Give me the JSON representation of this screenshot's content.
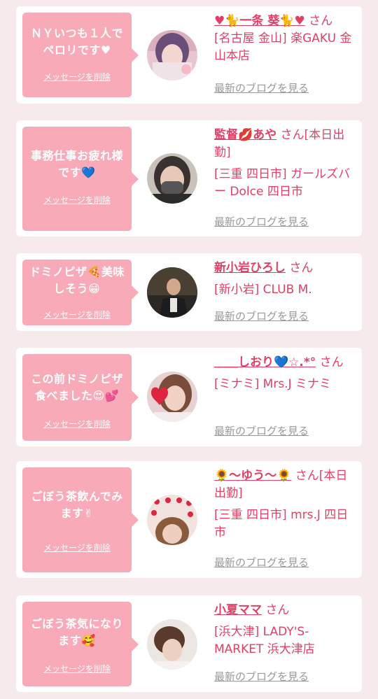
{
  "common": {
    "delete_label": "メッセージを削除",
    "blog_label": "最新のブログを見る",
    "san": "さん"
  },
  "cards": [
    {
      "message": "ＮＹいつも１人で\nペロリです♥",
      "name": "♥🐈一条 葵🐈♥",
      "name_suffix": "さん",
      "shop": "[名古屋 金山] 楽GAKU 金山本店"
    },
    {
      "message": "事務仕事お疲れ様\nです💙",
      "name": "監督💋あや",
      "name_suffix": "さん[本日出勤]",
      "shop": "[三重 四日市] ガールズバー Dolce 四日市"
    },
    {
      "message": "ドミノピザ🍕美味\nしそう😁",
      "name": "新小岩ひろし",
      "name_suffix": "さん",
      "shop": "[新小岩] CLUB M."
    },
    {
      "message": "この前ドミノピザ\n食べました😍💕",
      "name": "＿＿しおり💙☆.*°",
      "name_suffix": "さん",
      "shop": "[ミナミ] Mrs.J ミナミ"
    },
    {
      "message": "ごぼう茶飲んでみ\nます✌",
      "name": "🌻〜ゆう〜🌻",
      "name_suffix": "さん[本日出勤]",
      "shop": "[三重 四日市] mrs.J 四日市"
    },
    {
      "message": "ごぼう茶気になり\nます🥰",
      "name": "小夏ママ",
      "name_suffix": "さん",
      "shop": "[浜大津] LADY'S-MARKET 浜大津店"
    }
  ]
}
